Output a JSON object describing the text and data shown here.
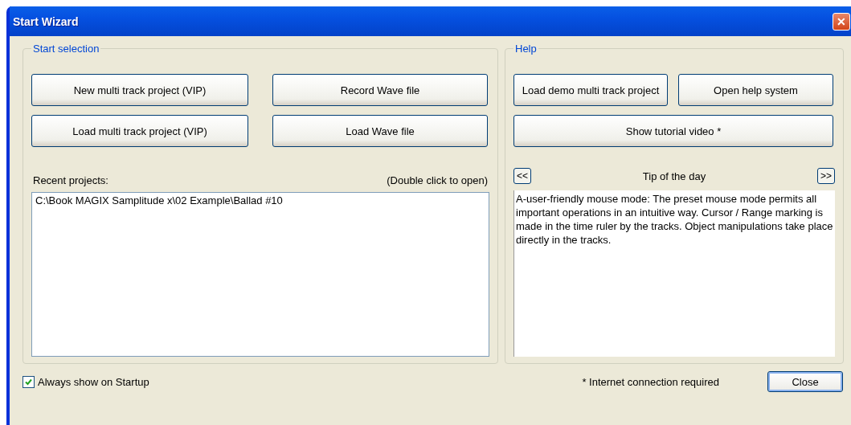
{
  "window": {
    "title": "Start Wizard",
    "close_symbol": "✕"
  },
  "start_selection": {
    "legend": "Start selection",
    "buttons": [
      "New multi track project (VIP)",
      "Record Wave file",
      "Load multi track project (VIP)",
      "Load Wave file"
    ],
    "recent_label": "Recent projects:",
    "recent_hint": "(Double click to open)",
    "recent_projects": [
      {
        "path": "C:\\Book MAGIX Samplitude x\\02 Example\\Ballad #10",
        "selected": false
      }
    ]
  },
  "help": {
    "legend": "Help",
    "buttons": [
      "Load demo multi track project",
      "Open help system"
    ],
    "wide_button": "Show tutorial video *",
    "tip": {
      "prev": "<<",
      "title": "Tip of the day",
      "next": ">>",
      "text": "A-user-friendly mouse mode: The preset mouse mode permits all important operations in an intuitive way. Cursor / Range marking is made in the time ruler by the tracks. Object manipulations take place directly in the tracks."
    }
  },
  "footer": {
    "always_show": {
      "label": "Always show on Startup",
      "checked": true
    },
    "note": "*  Internet connection required",
    "close": "Close"
  }
}
